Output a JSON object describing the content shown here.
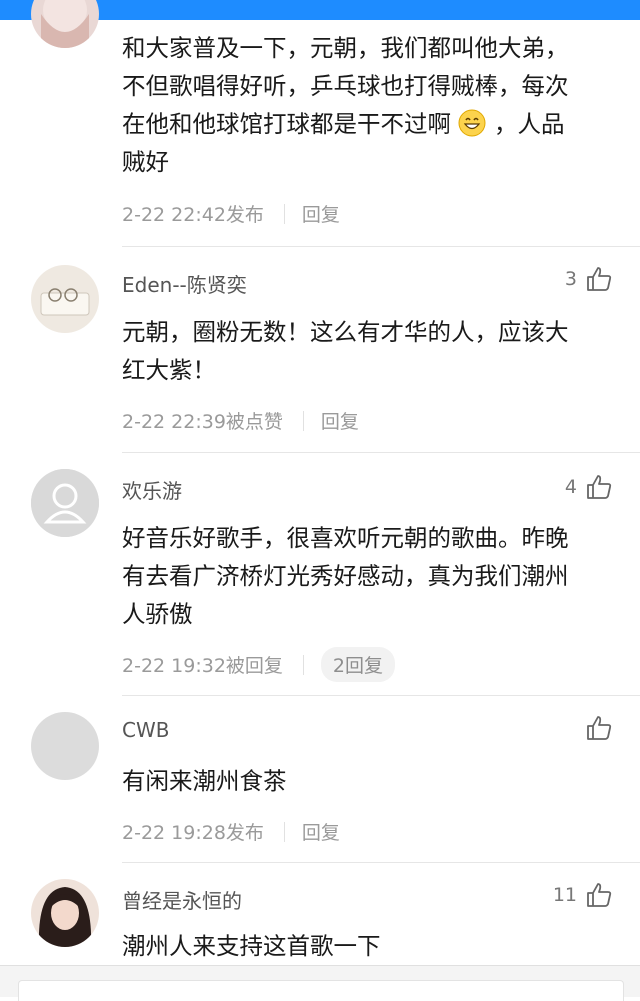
{
  "comments": [
    {
      "text_lines": [
        "和大家普及一下，元朝，我们都叫他大弟，",
        "不但歌唱得好听，乒乓球也打得贼棒，每次",
        "在他和他球馆打球都是干不过啊",
        "贼好"
      ],
      "text_line3_suffix": "，人品",
      "emoji": "grinning-face-emoji",
      "meta": "2-22 22:42发布",
      "reply": "回复"
    },
    {
      "username": "Eden--陈贤奕",
      "likes": "3",
      "text_lines": [
        "元朝，圈粉无数！这么有才华的人，应该大",
        "红大紫！"
      ],
      "meta": "2-22 22:39被点赞",
      "reply": "回复"
    },
    {
      "username": "欢乐游",
      "likes": "4",
      "text_lines": [
        "好音乐好歌手，很喜欢听元朝的歌曲。昨晚",
        "有去看广济桥灯光秀好感动，真为我们潮州",
        "人骄傲"
      ],
      "meta": "2-22 19:32被回复",
      "reply": "2回复"
    },
    {
      "username": "CWB",
      "likes": "",
      "text_lines": [
        "有闲来潮州食茶"
      ],
      "meta": "2-22 19:28发布",
      "reply": "回复"
    },
    {
      "username": "曾经是永恒的",
      "likes": "11",
      "text_lines": [
        "潮州人来支持这首歌一下"
      ]
    }
  ],
  "colors": {
    "accent_blue": "#1e8cff",
    "meta_gray": "#9a9a9a"
  }
}
